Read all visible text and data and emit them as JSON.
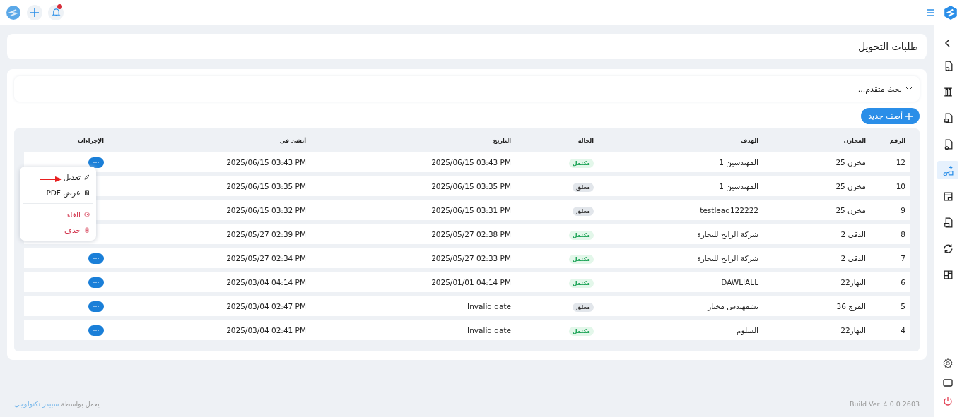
{
  "topbar": {
    "notifications": {
      "unread": true
    }
  },
  "sidebar": {
    "items": [
      {
        "selected": false
      },
      {
        "selected": false
      },
      {
        "selected": false
      },
      {
        "selected": false
      },
      {
        "selected": true
      },
      {
        "selected": false
      },
      {
        "selected": false
      },
      {
        "selected": false
      },
      {
        "selected": false
      }
    ]
  },
  "page": {
    "title": "طلبات التحويل"
  },
  "search": {
    "label": "بحث متقدم...",
    "expanded": false
  },
  "add_button": "أضف جديد",
  "table": {
    "columns": [
      "الرقم",
      "المخازن",
      "الهدف",
      "الحالة",
      "التاريخ",
      "أنشئ في",
      "الإجراءات"
    ],
    "rows": [
      {
        "number": "12",
        "store": "مخزن 25",
        "target": "المهندسين 1",
        "status": {
          "kind": "complete",
          "label": "مكتمل"
        },
        "date": "2025/06/15 03:43 PM",
        "created": "2025/06/15 03:43 PM",
        "actions": "···"
      },
      {
        "number": "10",
        "store": "مخزن 25",
        "target": "المهندسين 1",
        "status": {
          "kind": "pending",
          "label": "معلق"
        },
        "date": "2025/06/15 03:35 PM",
        "created": "2025/06/15 03:35 PM"
      },
      {
        "number": "9",
        "store": "مخزن 25",
        "target": "testlead122222",
        "status": {
          "kind": "pending",
          "label": "معلق"
        },
        "date": "2025/06/15 03:31 PM",
        "created": "2025/06/15 03:32 PM"
      },
      {
        "number": "8",
        "store": "الدقى 2",
        "target": "شركة الرابح للتجارة",
        "status": {
          "kind": "complete",
          "label": "مكتمل"
        },
        "date": "2025/05/27 02:38 PM",
        "created": "2025/05/27 02:39 PM"
      },
      {
        "number": "7",
        "store": "الدقى 2",
        "target": "شركة الرابح للتجارة",
        "status": {
          "kind": "complete",
          "label": "مكتمل"
        },
        "date": "2025/05/27 02:33 PM",
        "created": "2025/05/27 02:34 PM",
        "actions": "···"
      },
      {
        "number": "6",
        "store": "النهار22",
        "target": "DAWLIALL",
        "status": {
          "kind": "complete",
          "label": "مكتمل"
        },
        "date": "2025/01/01 04:14 PM",
        "created": "2025/03/04 04:14 PM",
        "actions": "···"
      },
      {
        "number": "5",
        "store": "المرج 36",
        "target": "بشمهندس مختار",
        "status": {
          "kind": "pending",
          "label": "معلق"
        },
        "date": "Invalid date",
        "created": "2025/03/04 02:47 PM",
        "actions": "···"
      },
      {
        "number": "4",
        "store": "النهار22",
        "target": "السلوم",
        "status": {
          "kind": "complete",
          "label": "مكتمل"
        },
        "date": "Invalid date",
        "created": "2025/03/04 02:41 PM",
        "actions": "···"
      }
    ]
  },
  "action_menu": {
    "items": [
      {
        "kind": "edit",
        "label": "تعديل"
      },
      {
        "kind": "pdf",
        "label": "عرض PDF"
      },
      {
        "kind": "cancel",
        "label": "الغاء"
      },
      {
        "kind": "delete",
        "label": "حذف"
      }
    ]
  },
  "footer": {
    "powered_by": "يعمل بواسطة",
    "company": "سبيدر تكنولوجي",
    "build": "Build Ver. 4.0.0.2603"
  }
}
